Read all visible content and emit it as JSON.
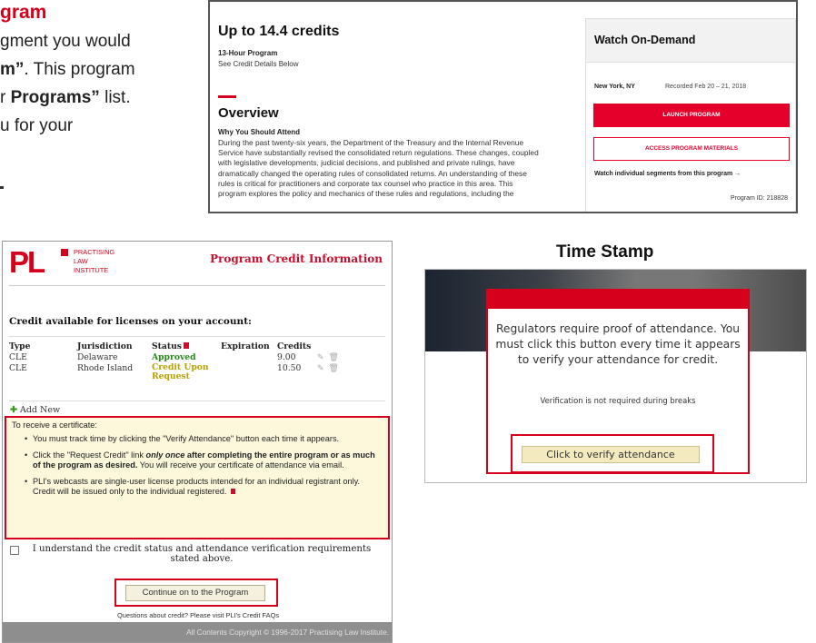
{
  "top_left": {
    "heading": "gram",
    "line1": "gment you would",
    "line2_bold": "m”",
    "line2_rest": ". This program",
    "line3_pre": "r ",
    "line3_bold": "Programs”",
    "line3_rest": " list.",
    "line4": "u for your"
  },
  "program_card": {
    "title": "Up to 14.4 credits",
    "hours": "13-Hour Program",
    "credit_link": "See Credit Details Below",
    "overview_heading": "Overview",
    "why_heading": "Why You Should Attend",
    "body_lines": [
      "During the past twenty-six years, the Department of the Treasury and the Internal Revenue",
      "Service have substantially revised the consolidated return regulations. These changes, coupled",
      "with legislative developments, judicial decisions, and published and private rulings, have",
      "dramatically changed the operating rules of consolidated returns. An understanding of these",
      "rules is critical for practitioners and corporate tax counsel who practice in this area. This",
      "program explores the policy and mechanics of these rules and regulations, including the"
    ],
    "panel_title": "Watch On-Demand",
    "location": "New York, NY",
    "recorded": "Recorded Feb 20 – 21, 2018",
    "launch_label": "LAUNCH PROGRAM",
    "materials_label": "ACCESS PROGRAM MATERIALS",
    "segments_link": "Watch individual segments from this program",
    "arrow": "→",
    "program_id": "Program ID: 218828"
  },
  "credit_dialog": {
    "logo_letters": "PL",
    "logo_words": [
      "PRACTISING",
      "LAW",
      "INSTITUTE"
    ],
    "title": "Program Credit Information",
    "available_heading": "Credit available for licenses on your account:",
    "columns": [
      "Type",
      "Jurisdiction",
      "Status",
      "Expiration",
      "Credits"
    ],
    "rows": [
      {
        "type": "CLE",
        "jurisdiction": "Delaware",
        "status": "Approved",
        "expiration": "",
        "credits": "9.00"
      },
      {
        "type": "CLE",
        "jurisdiction": "Rhode Island",
        "status": "Credit Upon Request",
        "expiration": "",
        "credits": "10.50"
      }
    ],
    "add_new": "Add New",
    "cert_heading": "To receive a certificate:",
    "bullet1": "You must track time by clicking the \"Verify Attendance\" button each time it appears.",
    "bullet2_pre": "Click the \"Request Credit\" link ",
    "bullet2_em": "only once",
    "bullet2_bold": " after completing the entire program or as much of the program as desired.",
    "bullet2_bold2": " You will receive your",
    "bullet2_rest": "certificate of attendance via email.",
    "bullet3": "PLI's webcasts are single-user license products intended for an individual registrant only. Credit will be issued only to the individual registered.",
    "acknowledge": "I understand the credit status and attendance verification requirements stated above.",
    "continue_label": "Continue on to the Program",
    "faq": "Questions about credit? Please visit PLI's Credit FAQs",
    "copyright": "All Contents Copyright © 1996-2017 Practising Law Institute."
  },
  "time_stamp": {
    "title": "Time Stamp",
    "message": "Regulators require proof of attendance. You must click this button every time it appears to verify your attendance for credit.",
    "note": "Verification is not required during breaks",
    "verify_label": "Click to verify attendance"
  },
  "colors": {
    "brand_red": "#d6001c",
    "approved_green": "#2a8a1e",
    "request_yellow": "#b8a000",
    "cert_bg": "#fdf8dc"
  },
  "icons": {
    "edit": "pencil-icon",
    "delete": "trash-icon",
    "add": "plus-icon",
    "status_flag": "flag-icon",
    "checkbox": "checkbox-icon",
    "arrow": "arrow-right-icon"
  }
}
